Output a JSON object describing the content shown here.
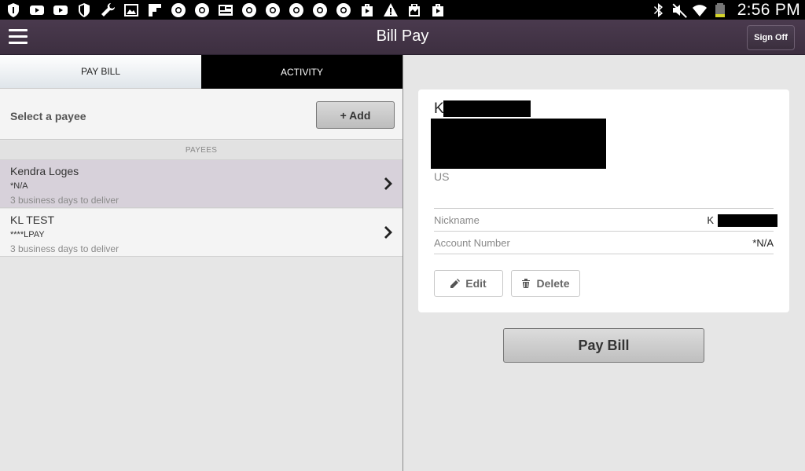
{
  "status_bar": {
    "time": "2:56 PM",
    "left_icons": [
      "shield-icon",
      "youtube-icon",
      "youtube-icon",
      "security-shield-icon",
      "wrench-icon",
      "image-icon",
      "flipboard-icon",
      "chrome-icon",
      "chrome-icon",
      "news-icon",
      "chrome-icon",
      "chrome-icon",
      "chrome-icon",
      "chrome-icon",
      "chrome-icon",
      "play-store-icon",
      "warning-icon",
      "clipboard-icon",
      "play-store-icon"
    ],
    "right_icons": [
      "bluetooth-icon",
      "mute-icon",
      "wifi-icon",
      "battery-icon"
    ]
  },
  "app_bar": {
    "title": "Bill Pay",
    "sign_off_label": "Sign Off"
  },
  "tabs": [
    {
      "label": "PAY BILL",
      "active": true
    },
    {
      "label": "ACTIVITY",
      "active": false
    }
  ],
  "select_payee": {
    "label": "Select a payee",
    "add_label": "+ Add"
  },
  "payees_header": "PAYEES",
  "payees": [
    {
      "name": "Kendra Loges",
      "account": "*N/A",
      "delivery": "3 business days to deliver",
      "selected": true
    },
    {
      "name": "KL TEST",
      "account": "****LPAY",
      "delivery": "3 business days to deliver",
      "selected": false
    }
  ],
  "detail": {
    "name_initial": "K",
    "country": "US",
    "nickname_label": "Nickname",
    "nickname_value": "K",
    "account_label": "Account Number",
    "account_value": "*N/A",
    "edit_label": "Edit",
    "delete_label": "Delete"
  },
  "pay_bill_label": "Pay Bill",
  "colors": {
    "app_bar": "#3d2f40",
    "selected_row": "#d7d1da",
    "background": "#e6e6e6"
  }
}
